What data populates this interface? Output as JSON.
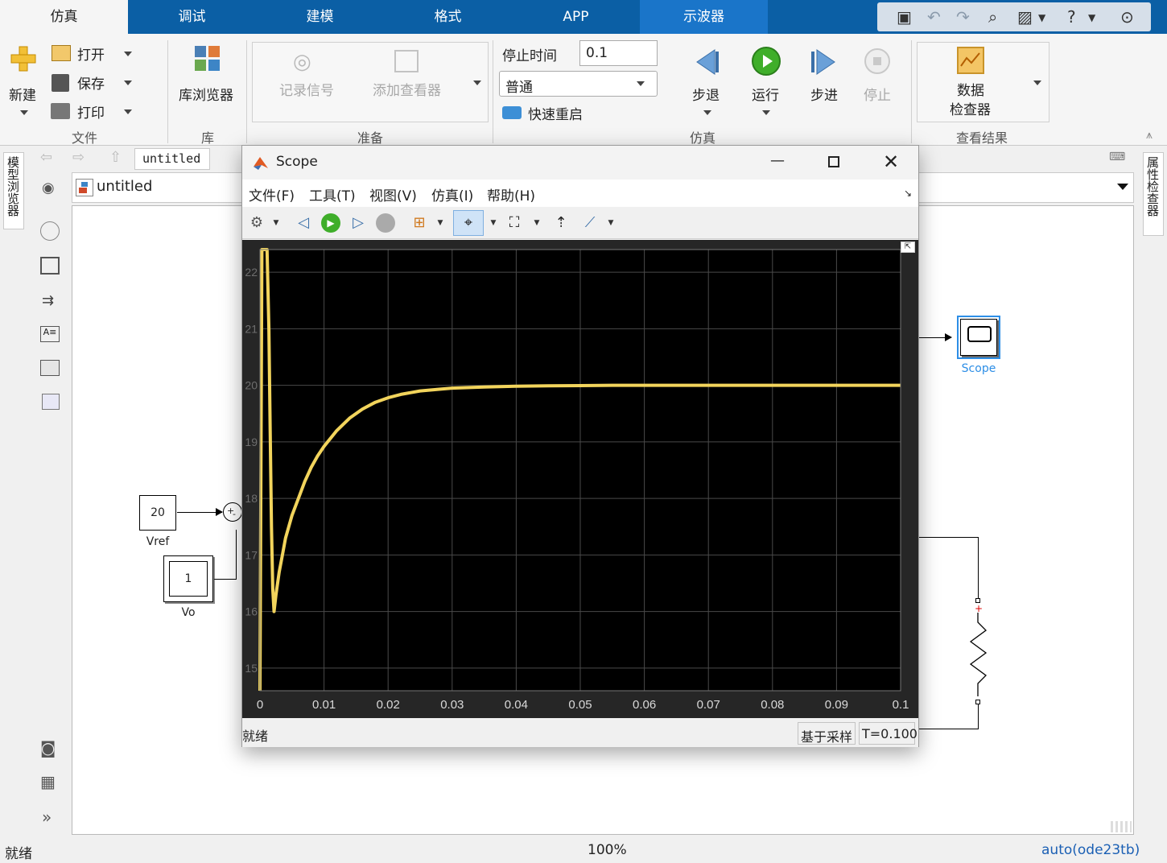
{
  "tabs": [
    {
      "label": "仿真"
    },
    {
      "label": "调试"
    },
    {
      "label": "建模"
    },
    {
      "label": "格式"
    },
    {
      "label": "APP"
    },
    {
      "label": "示波器"
    }
  ],
  "file": {
    "new": "新建",
    "open": "打开",
    "save": "保存",
    "print": "打印",
    "section": "文件"
  },
  "library": {
    "browser": "库浏览器",
    "section": "库"
  },
  "prepare": {
    "log": "记录信号",
    "viewer": "添加查看器",
    "section": "准备"
  },
  "sim": {
    "stop_time_label": "停止时间",
    "stop_time": "0.1",
    "mode": "普通",
    "fast_restart": "快速重启",
    "step_back": "步退",
    "run": "运行",
    "step_fwd": "步进",
    "stop": "停止",
    "section": "仿真"
  },
  "results": {
    "sdi_line1": "数据",
    "sdi_line2": "检查器",
    "section": "查看结果"
  },
  "left_panel": "模型浏览器",
  "right_panel": "属性检查器",
  "breadcrumb_tab": "untitled",
  "model_path": "untitled",
  "blocks": {
    "vref_value": "20",
    "vref_label": "Vref",
    "vo_value": "1",
    "vo_label": "Vo",
    "sum_plus": "+",
    "sum_minus": "-",
    "scope_label": "Scope",
    "res_plus": "+"
  },
  "status": {
    "left": "就绪",
    "zoom": "100%",
    "solver": "auto(ode23tb)"
  },
  "scope": {
    "title": "Scope",
    "menus": [
      {
        "label": "文件(F)"
      },
      {
        "label": "工具(T)"
      },
      {
        "label": "视图(V)"
      },
      {
        "label": "仿真(I)"
      },
      {
        "label": "帮助(H)"
      }
    ],
    "status_left": "就绪",
    "status_mode": "基于采样",
    "status_time": "T=0.100"
  },
  "chart_data": {
    "type": "line",
    "title": "",
    "xlabel": "",
    "ylabel": "",
    "xlim": [
      0,
      0.1
    ],
    "ylim": [
      14.6,
      22.4
    ],
    "xticks": [
      0,
      0.01,
      0.02,
      0.03,
      0.04,
      0.05,
      0.06,
      0.07,
      0.08,
      0.09,
      0.1
    ],
    "xtick_labels": [
      "0",
      "0.01",
      "0.02",
      "0.03",
      "0.04",
      "0.05",
      "0.06",
      "0.07",
      "0.08",
      "0.09",
      "0.1"
    ],
    "yticks": [
      15,
      16,
      17,
      18,
      19,
      20,
      21,
      22
    ],
    "ytick_labels": [
      "15",
      "16",
      "17",
      "18",
      "19",
      "20",
      "21",
      "22"
    ],
    "grid": true,
    "colors": {
      "background": "#000000",
      "grid": "#4a4a4a",
      "line": "#f2d45c",
      "tick": "#d9d9d9"
    },
    "series": [
      {
        "x": [
          0,
          0.0003,
          0.0005,
          0.0008,
          0.0011,
          0.0014,
          0.0016,
          0.0018,
          0.002,
          0.0022,
          0.0025,
          0.003,
          0.0035,
          0.004,
          0.005,
          0.006,
          0.007,
          0.008,
          0.009,
          0.01,
          0.012,
          0.014,
          0.016,
          0.018,
          0.02,
          0.022,
          0.025,
          0.028,
          0.03,
          0.035,
          0.04,
          0.045,
          0.05,
          0.055,
          0.06,
          0.07,
          0.08,
          0.09,
          0.1
        ],
        "y": [
          14.6,
          22.4,
          22.4,
          22.4,
          22.4,
          21.0,
          19.2,
          17.5,
          16.4,
          16.0,
          16.3,
          16.7,
          17.0,
          17.3,
          17.7,
          18.0,
          18.3,
          18.55,
          18.75,
          18.92,
          19.2,
          19.42,
          19.58,
          19.7,
          19.78,
          19.84,
          19.9,
          19.93,
          19.95,
          19.97,
          19.985,
          19.99,
          19.995,
          20,
          20,
          20,
          20,
          20,
          20
        ]
      }
    ]
  }
}
